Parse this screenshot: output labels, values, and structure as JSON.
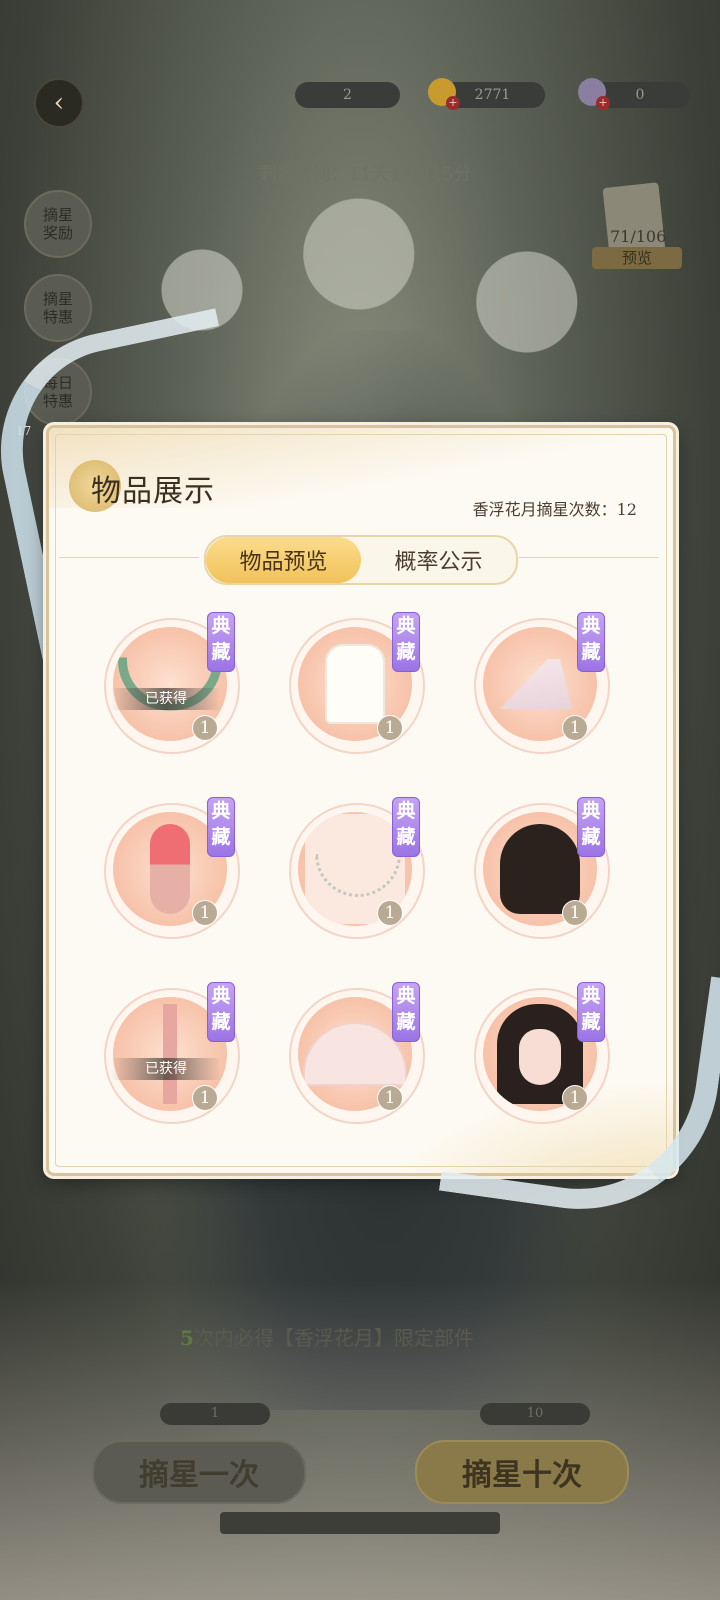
{
  "topbar": {
    "currency1": "2",
    "currency2": "2771",
    "currency3": "0"
  },
  "timer": "剩余时间：11天17时45分",
  "side_buttons": [
    {
      "label": "摘星奖励"
    },
    {
      "label": "摘星特惠"
    },
    {
      "label": "每日特惠"
    }
  ],
  "side_small_label": "17",
  "preview": {
    "count": "71/106",
    "label": "预览"
  },
  "modal": {
    "title": "物品展示",
    "draw_count_label": "香浮花月摘星次数：12",
    "tabs": [
      {
        "label": "物品预览",
        "active": true
      },
      {
        "label": "概率公示",
        "active": false
      }
    ],
    "items": [
      {
        "tag": "典藏",
        "qty": "1",
        "owned": "已获得",
        "icon": "headpiece-wreath"
      },
      {
        "tag": "典藏",
        "qty": "1",
        "owned": "",
        "icon": "white-robe"
      },
      {
        "tag": "典藏",
        "qty": "1",
        "owned": "",
        "icon": "root-floor-effect"
      },
      {
        "tag": "典藏",
        "qty": "1",
        "owned": "",
        "icon": "flower-hairpin"
      },
      {
        "tag": "典藏",
        "qty": "1",
        "owned": "",
        "icon": "necklace"
      },
      {
        "tag": "典藏",
        "qty": "1",
        "owned": "",
        "icon": "hair-style"
      },
      {
        "tag": "典藏",
        "qty": "1",
        "owned": "已获得",
        "icon": "ribbon-accessory"
      },
      {
        "tag": "典藏",
        "qty": "1",
        "owned": "",
        "icon": "umbrella"
      },
      {
        "tag": "典藏",
        "qty": "1",
        "owned": "",
        "icon": "makeup-face"
      }
    ]
  },
  "draw": {
    "info_num": "5",
    "info_text": "次内必得【香浮花月】限定部件",
    "cost_once": "1",
    "cost_ten": "10",
    "once_label": "摘星一次",
    "ten_label": "摘星十次"
  },
  "colors": {
    "accent": "#f1c25a",
    "tag": "#9b74e5",
    "modal_bg": "#fdfaf3"
  }
}
